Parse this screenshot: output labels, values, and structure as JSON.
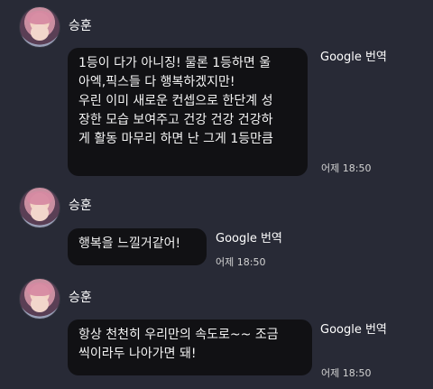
{
  "messages": [
    {
      "sender": "승훈",
      "lines": [
        "1등이 다가 아니징! 물론 1등하면 울",
        "아엑,픽스들 다 행복하겠지만!",
        "우린 이미 새로운 컨셉으로 한단계 성",
        "장한 모습 보여주고 건강 건강 건강하",
        "게 활동 마무리 하면 난 그게 1등만큼"
      ],
      "translate_label": "Google 번역",
      "time": "어제 18:50"
    },
    {
      "sender": "승훈",
      "lines": [
        "행복을 느낄거같어!"
      ],
      "translate_label": "Google 번역",
      "time": "어제 18:50"
    },
    {
      "sender": "승훈",
      "lines": [
        "항상 천천히 우리만의 속도로~~ 조금",
        "씩이라두 나아가면 돼!"
      ],
      "translate_label": "Google 번역",
      "time": "어제 18:50"
    }
  ]
}
